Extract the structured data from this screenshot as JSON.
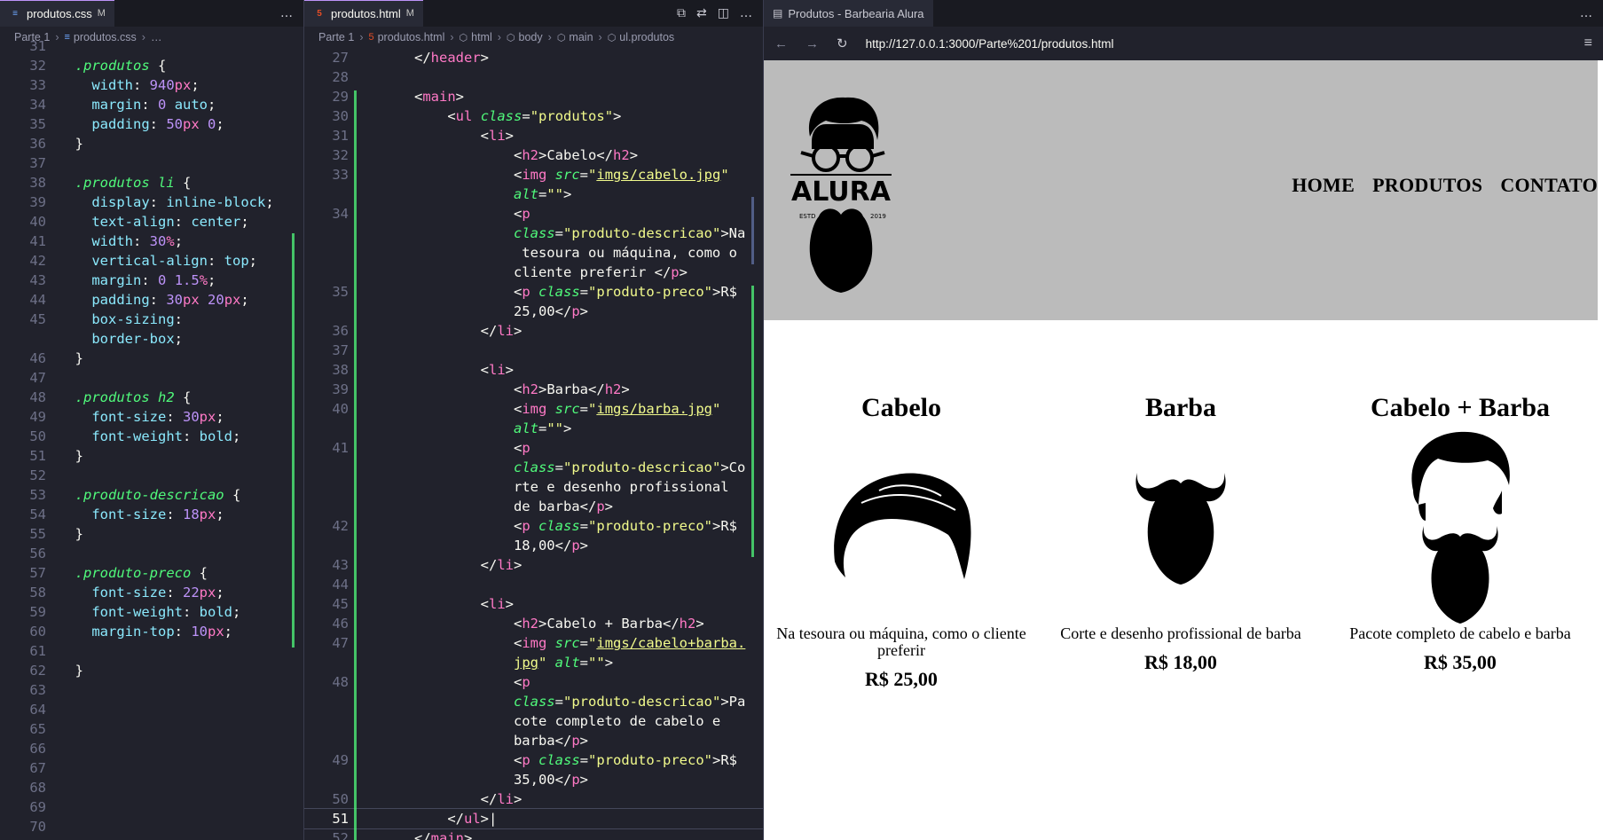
{
  "css_editor": {
    "tab": {
      "filename": "produtos.css",
      "status": "M"
    },
    "more": "…",
    "breadcrumb": {
      "folder": "Parte 1",
      "file": "produtos.css",
      "tail": "…"
    }
  },
  "html_editor": {
    "tab": {
      "filename": "produtos.html",
      "status": "M"
    },
    "breadcrumb": {
      "folder": "Parte 1",
      "file": "produtos.html",
      "items": [
        "html",
        "body",
        "main",
        "ul.produtos"
      ]
    }
  },
  "browser": {
    "tab_title": "Produtos - Barbearia Alura",
    "url": "http://127.0.0.1:3000/Parte%201/produtos.html",
    "logo_text": "ALURA",
    "logo_estd": "ESTD",
    "logo_year": "2019",
    "nav": [
      "HOME",
      "PRODUTOS",
      "CONTATO"
    ],
    "products": [
      {
        "title": "Cabelo",
        "description": "Na tesoura ou máquina, como o cliente preferir",
        "price": "R$ 25,00",
        "image": "hair-icon"
      },
      {
        "title": "Barba",
        "description": "Corte e desenho profissional de barba",
        "price": "R$ 18,00",
        "image": "beard-icon"
      },
      {
        "title": "Cabelo + Barba",
        "description": "Pacote completo de cabelo e barba",
        "price": "R$ 35,00",
        "image": "hair-beard-icon"
      }
    ]
  },
  "colors": {
    "editor_bg": "#21222c",
    "header_bg": "#bbbbbb",
    "accent": "#bd93f9",
    "git_added": "#50fa7b"
  }
}
